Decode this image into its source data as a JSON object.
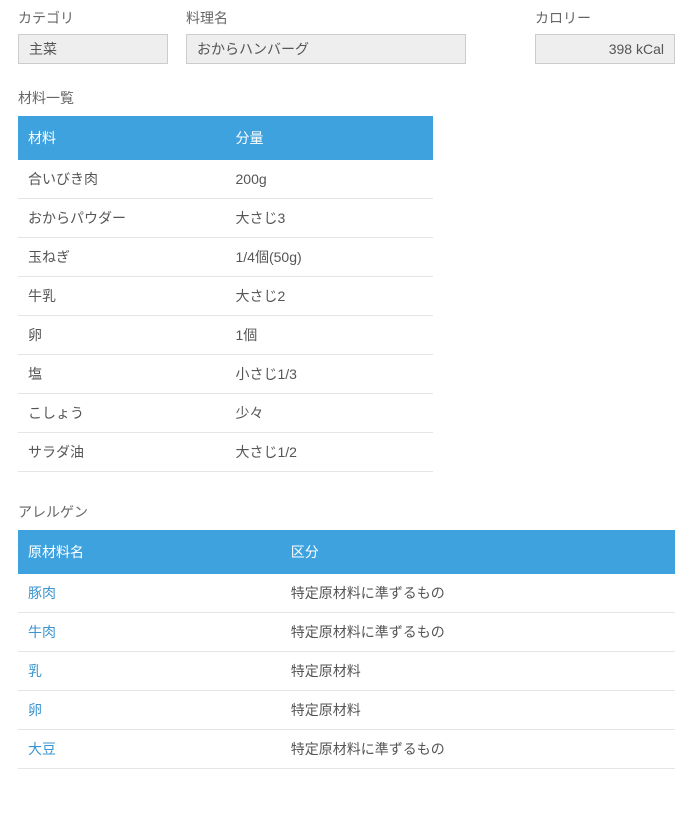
{
  "labels": {
    "category": "カテゴリ",
    "recipe": "料理名",
    "calorie": "カロリー",
    "ingredients_title": "材料一覧",
    "allergen_title": "アレルゲン",
    "col_ingredient": "材料",
    "col_amount": "分量",
    "col_allergen_name": "原材料名",
    "col_allergen_type": "区分"
  },
  "values": {
    "category": "主菜",
    "recipe": "おからハンバーグ",
    "calorie": "398 kCal"
  },
  "ingredients": [
    {
      "name": "合いびき肉",
      "amount": "200g"
    },
    {
      "name": "おからパウダー",
      "amount": "大さじ3"
    },
    {
      "name": "玉ねぎ",
      "amount": "1/4個(50g)"
    },
    {
      "name": "牛乳",
      "amount": "大さじ2"
    },
    {
      "name": "卵",
      "amount": "1個"
    },
    {
      "name": "塩",
      "amount": "小さじ1/3"
    },
    {
      "name": "こしょう",
      "amount": "少々"
    },
    {
      "name": "サラダ油",
      "amount": "大さじ1/2"
    }
  ],
  "allergens": [
    {
      "name": "豚肉",
      "type": "特定原材料に準ずるもの"
    },
    {
      "name": "牛肉",
      "type": "特定原材料に準ずるもの"
    },
    {
      "name": "乳",
      "type": "特定原材料"
    },
    {
      "name": "卵",
      "type": "特定原材料"
    },
    {
      "name": "大豆",
      "type": "特定原材料に準ずるもの"
    }
  ]
}
